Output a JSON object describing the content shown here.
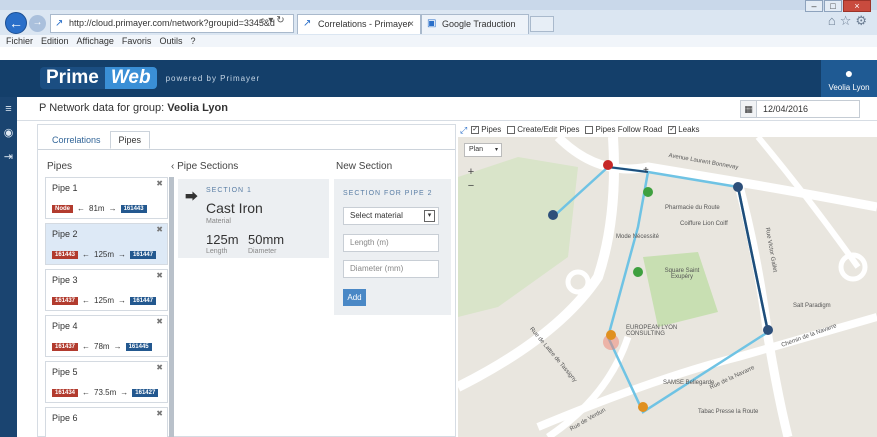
{
  "browser": {
    "url": "http://cloud.primayer.com/network?groupid=3345&d",
    "tabs": [
      {
        "label": "Correlations - Primayer"
      },
      {
        "label": "Google Traduction"
      }
    ],
    "menu": [
      "Fichier",
      "Edition",
      "Affichage",
      "Favoris",
      "Outils",
      "?"
    ],
    "window_controls": [
      "–",
      "□",
      "×"
    ]
  },
  "app": {
    "logo_prime": "Prime",
    "logo_web": "Web",
    "tagline": "powered by Primayer",
    "user_name": "Veolia Lyon"
  },
  "group": {
    "prefix": "Network data for group:",
    "name": "Veolia Lyon",
    "date": "12/04/2016"
  },
  "panel_tabs": [
    {
      "label": "Correlations"
    },
    {
      "label": "Pipes"
    }
  ],
  "pipes_header": "Pipes",
  "sections_header": "Pipe Sections",
  "new_section_header": "New Section",
  "pipes": [
    {
      "name": "Pipe 1",
      "from": "Node",
      "length": "81m",
      "to": "161443",
      "from_color": "red"
    },
    {
      "name": "Pipe 2",
      "from": "161443",
      "length": "125m",
      "to": "161447",
      "from_color": "red"
    },
    {
      "name": "Pipe 3",
      "from": "161437",
      "length": "125m",
      "to": "161447",
      "from_color": "red"
    },
    {
      "name": "Pipe 4",
      "from": "161437",
      "length": "78m",
      "to": "161445",
      "from_color": "red"
    },
    {
      "name": "Pipe 5",
      "from": "161434",
      "length": "73.5m",
      "to": "161427",
      "from_color": "red"
    },
    {
      "name": "Pipe 6",
      "from": "",
      "length": "",
      "to": "",
      "from_color": "red"
    }
  ],
  "section": {
    "label": "SECTION 1",
    "material": "Cast Iron",
    "material_label": "Material",
    "length": "125m",
    "length_label": "Length",
    "diameter": "50mm",
    "diameter_label": "Diameter"
  },
  "new_section": {
    "label": "SECTION FOR PIPE 2",
    "material_select": "Select material",
    "length_placeholder": "Length (m)",
    "diameter_placeholder": "Diameter (mm)",
    "add_label": "Add"
  },
  "map_options": [
    {
      "label": "Pipes",
      "checked": true
    },
    {
      "label": "Create/Edit Pipes",
      "checked": false
    },
    {
      "label": "Pipes Follow Road",
      "checked": false
    },
    {
      "label": "Leaks",
      "checked": true
    }
  ],
  "map": {
    "type": "Plan",
    "pois": [
      {
        "label": "Pharmacie du Route"
      },
      {
        "label": "Coiffure Lion Coiff"
      },
      {
        "label": "Mode Nécessité"
      },
      {
        "label": "Square Saint Exupéry"
      },
      {
        "label": "Salt Paradigm"
      },
      {
        "label": "EUROPEAN LYON CONSULTING"
      },
      {
        "label": "SAMSE Bellegarde"
      },
      {
        "label": "Tabac Presse la Route"
      },
      {
        "label": "Rue de Lattre de Tassigny"
      },
      {
        "label": "Avenue Laurent Bonnevay"
      },
      {
        "label": "Rue Victor Gallet"
      },
      {
        "label": "Chemin de la Navarre"
      },
      {
        "label": "Rue de la Navarre"
      },
      {
        "label": "Rue de Verdun"
      }
    ]
  },
  "colors": {
    "header_bg": "#143f6a",
    "accent": "#3a8fd6",
    "badge_red": "#b23b2e",
    "badge_blue": "#23588f"
  }
}
